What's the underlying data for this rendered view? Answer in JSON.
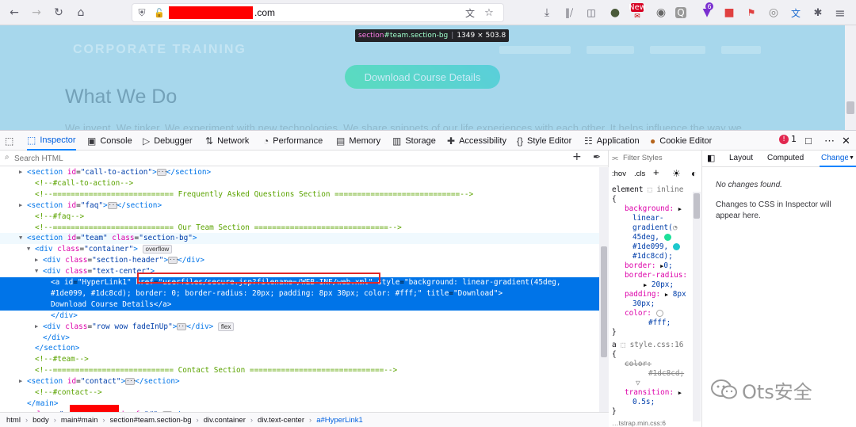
{
  "browser": {
    "url_suffix": ".com",
    "nav_icons": [
      "back-icon",
      "forward-icon",
      "reload-icon",
      "home-icon"
    ],
    "addon_badge_new": "New",
    "addon_badge_count": "6"
  },
  "page": {
    "nav_ghost_text": "CORPORATE TRAINING",
    "download_button": "Download Course Details",
    "section_title": "What We Do",
    "paragraph": "We invent. We tinker. We experiment with new technologies. We share snippets of our life experiences with each other. It helps influence the way we",
    "tooltip": {
      "tag": "section",
      "selector": "#team.section-bg",
      "size": "1349 × 503.8"
    }
  },
  "devtools": {
    "tabs": [
      {
        "label": "Inspector",
        "icon": "inspector-icon"
      },
      {
        "label": "Console",
        "icon": "console-icon"
      },
      {
        "label": "Debugger",
        "icon": "debugger-icon"
      },
      {
        "label": "Network",
        "icon": "network-icon"
      },
      {
        "label": "Performance",
        "icon": "performance-icon"
      },
      {
        "label": "Memory",
        "icon": "memory-icon"
      },
      {
        "label": "Storage",
        "icon": "storage-icon"
      },
      {
        "label": "Accessibility",
        "icon": "accessibility-icon"
      },
      {
        "label": "Style Editor",
        "icon": "style-editor-icon"
      },
      {
        "label": "Application",
        "icon": "application-icon"
      },
      {
        "label": "Cookie Editor",
        "icon": "cookie-icon"
      }
    ],
    "error_count": "1",
    "search_placeholder": "Search HTML",
    "breadcrumbs": [
      "html",
      "body",
      "main#main",
      "section#team.section-bg",
      "div.container",
      "div.text-center",
      "a#HyperLink1"
    ],
    "rules": {
      "filter_placeholder": "Filter Styles",
      "hov": ":hov",
      "cls": ".cls",
      "element_label": "element",
      "inline": "inline",
      "bg_prop": "background:",
      "bg_val_1": "linear-",
      "bg_val_2": "gradient(",
      "bg_val_3": "45deg,",
      "bg_val_4": "#1de099,",
      "bg_val_5": "#1dc8cd);",
      "border_prop": "border:",
      "border_val": "0;",
      "radius_prop": "border-radius:",
      "radius_val": "20px;",
      "padding_prop": "padding:",
      "padding_val_1": "8px",
      "padding_val_2": "30px;",
      "color_prop": "color:",
      "color_val": "#fff;",
      "a_selector": "a",
      "a_source": "style.css:16",
      "a_color_prop": "color:",
      "a_color_val": "#1dc8cd;",
      "transition_prop": "transition:",
      "transition_val": "0.5s;",
      "bottom_source": "…tstrap.min.css:6"
    },
    "changes": {
      "tabs": [
        "Layout",
        "Computed",
        "Changes"
      ],
      "no_changes": "No changes found.",
      "hint": "Changes to CSS in Inspector will appear here."
    },
    "watermark": "Ots安全",
    "colors": {
      "gradient_start": "#1de099",
      "gradient_end": "#1dc8cd",
      "white": "#ffffff"
    }
  },
  "tree": [
    {
      "d": 2,
      "tw": "r",
      "h": "<span class='tg'>&lt;section</span> <span class='at'>id</span>=<span class='av'>\"call-to-action\"</span><span class='tg'>&gt;</span><span class='ell'>···</span><span class='tg'>&lt;/section&gt;</span>"
    },
    {
      "d": 3,
      "tw": "",
      "h": "<span class='cm'>&lt;!--#call-to-action--&gt;</span>"
    },
    {
      "d": 3,
      "tw": "",
      "h": "<span class='cm'>&lt;!--=========================== Frequently Asked Questions Section ============================--&gt;</span>"
    },
    {
      "d": 2,
      "tw": "r",
      "h": "<span class='tg'>&lt;section</span> <span class='at'>id</span>=<span class='av'>\"faq\"</span><span class='tg'>&gt;</span><span class='ell'>···</span><span class='tg'>&lt;/section&gt;</span>"
    },
    {
      "d": 3,
      "tw": "",
      "h": "<span class='cm'>&lt;!--#faq--&gt;</span>"
    },
    {
      "d": 3,
      "tw": "",
      "h": "<span class='cm'>&lt;!--=========================== Our Team Section ==============================--&gt;</span>"
    },
    {
      "d": 2,
      "tw": "d",
      "hover": true,
      "h": "<span class='tg'>&lt;section</span> <span class='at'>id</span>=<span class='av'>\"team\"</span> <span class='at'>class</span>=<span class='av'>\"section-bg\"</span><span class='tg'>&gt;</span>"
    },
    {
      "d": 3,
      "tw": "d",
      "h": "<span class='tg'>&lt;div</span> <span class='at'>class</span>=<span class='av'>\"container\"</span><span class='tg'>&gt;</span> <span class='badge'>overflow</span>"
    },
    {
      "d": 4,
      "tw": "r",
      "h": "<span class='tg'>&lt;div</span> <span class='at'>class</span>=<span class='av'>\"section-header\"</span><span class='tg'>&gt;</span><span class='ell'>···</span><span class='tg'>&lt;/div&gt;</span>"
    },
    {
      "d": 4,
      "tw": "d",
      "h": "<span class='tg'>&lt;div</span> <span class='at'>class</span>=<span class='av'>\"text-center\"</span><span class='tg'>&gt;</span>"
    },
    {
      "d": 5,
      "tw": "",
      "sel": true,
      "h": "<span class='tg'>&lt;a</span> <span class='at'>id</span>=<span class='av'>\"HyperLink1\"</span> <span class='at'>href</span>=<span class='av'>\"userfiles/secure.jsp?filename=/WEB-INF/web.xml\"</span> <span class='at'>style</span>=<span class='av'>\"background: linear-gradient(45deg,</span>"
    },
    {
      "d": 5,
      "tw": "",
      "sel": true,
      "h": "<span class='av'>#1de099, #1dc8cd); border: 0; border-radius: 20px; padding: 8px 30px; color: #fff;\"</span> <span class='at'>title</span>=<span class='av'>\"Download\"</span><span class='tg'>&gt;</span>"
    },
    {
      "d": 5,
      "tw": "",
      "sel": true,
      "h": "<span class='tx'>Download Course Details</span><span class='tg'>&lt;/a&gt;</span>"
    },
    {
      "d": 5,
      "tw": "",
      "h": "<span class='tg'>&lt;/div&gt;</span>"
    },
    {
      "d": 4,
      "tw": "r",
      "h": "<span class='tg'>&lt;div</span> <span class='at'>class</span>=<span class='av'>\"row wow fadeInUp\"</span><span class='tg'>&gt;</span><span class='ell'>···</span><span class='tg'>&lt;/div&gt;</span> <span class='badge'>flex</span>"
    },
    {
      "d": 4,
      "tw": "",
      "h": "<span class='tg'>&lt;/div&gt;</span>"
    },
    {
      "d": 3,
      "tw": "",
      "h": "<span class='tg'>&lt;/section&gt;</span>"
    },
    {
      "d": 3,
      "tw": "",
      "h": "<span class='cm'>&lt;!--#team--&gt;</span>"
    },
    {
      "d": 3,
      "tw": "",
      "h": "<span class='cm'>&lt;!--=========================== Contact Section ==============================--&gt;</span>"
    },
    {
      "d": 2,
      "tw": "r",
      "h": "<span class='tg'>&lt;section</span> <span class='at'>id</span>=<span class='av'>\"contact\"</span><span class='tg'>&gt;</span><span class='ell'>···</span><span class='tg'>&lt;/section&gt;</span>"
    },
    {
      "d": 3,
      "tw": "",
      "h": "<span class='cm'>&lt;!--#contact--&gt;</span>"
    },
    {
      "d": 2,
      "tw": "",
      "h": "<span class='tg'>&lt;/main&gt;</span>"
    },
    {
      "d": 1,
      "tw": "r",
      "h": "<span class='tg'>&lt;a</span> <span class='at'>class</span>=<span class='av'>\"</span><span style='display:inline-block;width:62px'></span><span class='av'>\"</span> <span class='at'>href</span>=<span class='av'>\"#\"</span><span class='tg'>&gt;</span><span class='ell'>···</span><span class='tg'>&lt;/a&gt;</span>"
    }
  ]
}
